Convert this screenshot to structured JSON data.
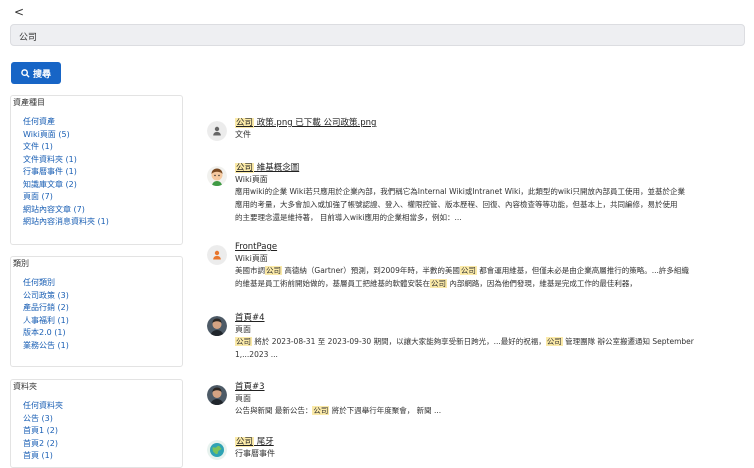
{
  "nav": {
    "back_glyph": "<"
  },
  "search": {
    "value": "公司",
    "button_label": "搜尋",
    "button_icon": "search-icon"
  },
  "facets": [
    {
      "title": "資產種目",
      "items": [
        "任何資產",
        "Wiki頁面 (5)",
        "文件 (1)",
        "文件資料夾 (1)",
        "行事曆事件 (1)",
        "知識庫文章 (2)",
        "頁面 (7)",
        "網站內容文章 (7)",
        "網站內容消息資料夾 (1)"
      ]
    },
    {
      "title": "類別",
      "items": [
        "任何類別",
        "公司政策 (3)",
        "產品行銷 (2)",
        "人事福利 (1)",
        "版本2.0 (1)",
        "業務公告 (1)"
      ]
    },
    {
      "title": "資料夾",
      "items": [
        "任何資料夾",
        "公告 (3)",
        "首頁1 (2)",
        "首頁2 (2)",
        "首頁 (1)"
      ]
    }
  ],
  "results": [
    {
      "avatar": "generic-user-avatar",
      "title_parts": [
        {
          "t": "公司",
          "h": true
        },
        {
          "t": " 政策.png 已下載 公司政策.png",
          "h": false
        }
      ],
      "type": "文件",
      "snippet_lines": []
    },
    {
      "avatar": "user-avatar-cartoon",
      "title_parts": [
        {
          "t": "公司",
          "h": true
        },
        {
          "t": " 維基概念圖",
          "h": false
        }
      ],
      "type": "Wiki頁面",
      "snippet_lines": [
        [
          {
            "t": "應用wiki的企業 Wiki若只應用於企業內部，我們稱它為Internal Wiki或Intranet Wiki，此類型的wiki只開放內部員工使用，並基於企業",
            "h": false
          }
        ],
        [
          {
            "t": "應用的考量，大多會加入或加強了帳號認證、登入、權限控管、版本歷程、回復、內容檢查等等功能，但基本上，共同編修，易於使用",
            "h": false
          }
        ],
        [
          {
            "t": "的主要理念還是維持著， 目前導入wiki應用的企業相當多，例如：...",
            "h": false
          }
        ]
      ]
    },
    {
      "avatar": "orange-user-avatar",
      "title_parts": [
        {
          "t": "FrontPage",
          "h": false
        }
      ],
      "type": "Wiki頁面",
      "snippet_lines": [
        [
          {
            "t": "美國市調",
            "h": false
          },
          {
            "t": "公司",
            "h": true
          },
          {
            "t": " 高德納（Gartner）預測，到2009年時，半數的美國",
            "h": false
          },
          {
            "t": "公司",
            "h": true
          },
          {
            "t": " 都會運用維基，但僅未必是由企業高層推行的策略。...許多組織",
            "h": false
          }
        ],
        [
          {
            "t": "的維基是員工術前開始做的，基層員工把維基的軟體安裝在",
            "h": false
          },
          {
            "t": "公司",
            "h": true
          },
          {
            "t": " 內部網路，因為他們發現，維基是完成工作的最佳利器，",
            "h": false
          }
        ]
      ]
    },
    {
      "avatar": "photo-avatar-man",
      "title_parts": [
        {
          "t": "首頁#4",
          "h": false
        }
      ],
      "type": "頁面",
      "snippet_lines": [
        [
          {
            "t": "公司",
            "h": true
          },
          {
            "t": " 將於 2023-08-31 至 2023-09-30 期間，以讓大家能夠享受新日跨光，...最好的祝福，",
            "h": false
          },
          {
            "t": "公司",
            "h": true
          },
          {
            "t": " 管理團隊 辦公室搬遷通知 September",
            "h": false
          }
        ],
        [
          {
            "t": "1,...2023 ...",
            "h": false
          }
        ]
      ]
    },
    {
      "avatar": "photo-avatar-man",
      "title_parts": [
        {
          "t": "首頁#3",
          "h": false
        }
      ],
      "type": "頁面",
      "snippet_lines": [
        [
          {
            "t": "公告與新聞 最新公告：",
            "h": false
          },
          {
            "t": "公司",
            "h": true
          },
          {
            "t": " 將於下週舉行年度聚會， 新聞 ...",
            "h": false
          }
        ]
      ]
    },
    {
      "avatar": "globe-avatar",
      "title_parts": [
        {
          "t": "公司",
          "h": true
        },
        {
          "t": " 尾牙",
          "h": false
        }
      ],
      "type": "行事曆事件",
      "snippet_lines": []
    }
  ],
  "colors": {
    "accent": "#1765c6",
    "link": "#1a5fb4",
    "highlight": "#fbeaa8",
    "search_bg": "#eeeff2"
  }
}
